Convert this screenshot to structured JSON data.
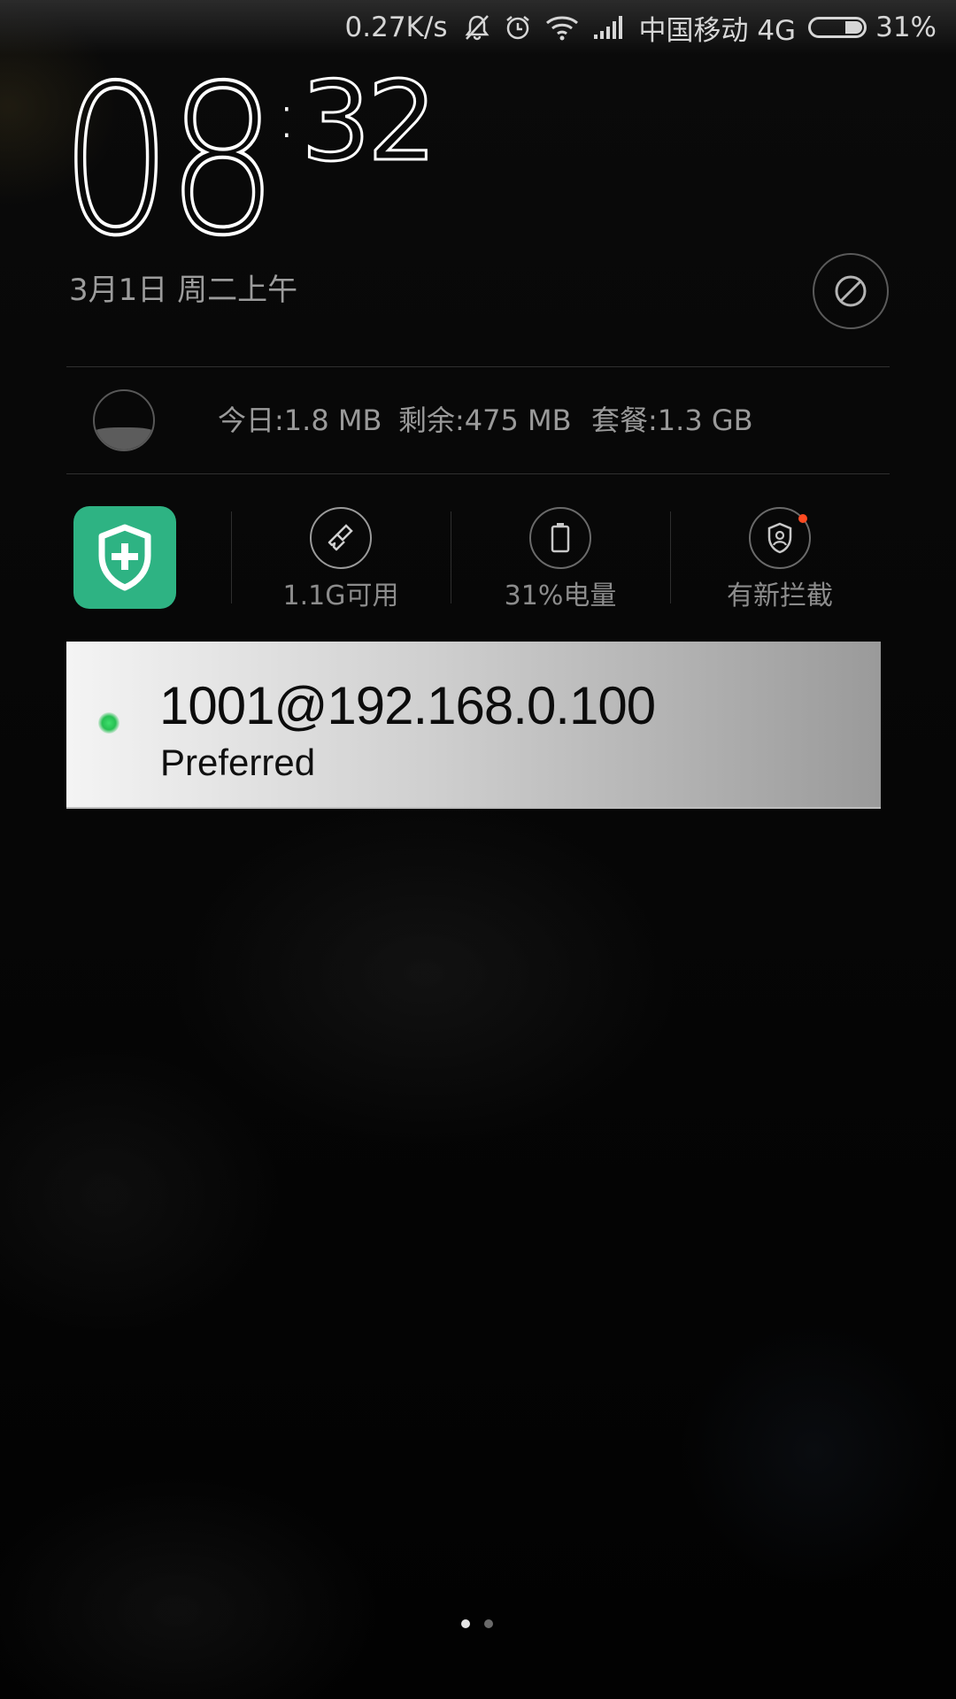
{
  "status_bar": {
    "net_speed": "0.27K/s",
    "carrier": "中国移动 4G",
    "battery_percent_text": "31%",
    "battery_level": 0.31,
    "icons": [
      "mute-icon",
      "alarm-icon",
      "wifi-icon",
      "signal-icon",
      "battery-icon"
    ]
  },
  "clock": {
    "hours": "08",
    "colon": ":",
    "minutes": "32"
  },
  "date": "3月1日 周二上午",
  "data_usage": {
    "today": "今日:1.8 MB",
    "remaining": "剩余:475 MB",
    "plan": "套餐:1.3 GB",
    "gauge_level": 0.38
  },
  "quick_tools": {
    "app_icon": "security-shield-icon",
    "items": [
      {
        "label": "1.1G可用",
        "icon": "broom-icon"
      },
      {
        "label": "31%电量",
        "icon": "battery-icon"
      },
      {
        "label": "有新拦截",
        "icon": "shield-user-icon"
      }
    ]
  },
  "notification": {
    "title": "1001@192.168.0.100",
    "subtitle": "Preferred",
    "status_color": "#2fcf5c"
  },
  "pager": {
    "pages": 2,
    "active": 1
  },
  "colors": {
    "accent_green": "#2eb383",
    "alert_red": "#ff4a21"
  }
}
